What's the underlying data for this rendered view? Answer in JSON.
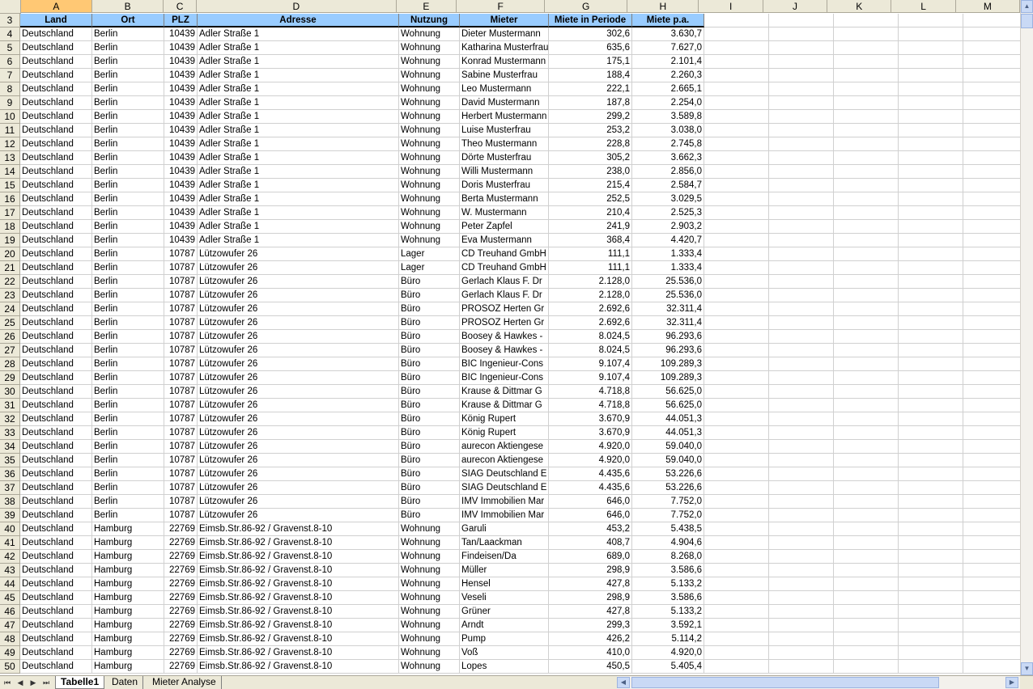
{
  "columns": [
    "A",
    "B",
    "C",
    "D",
    "E",
    "F",
    "G",
    "H",
    "I",
    "J",
    "K",
    "L",
    "M"
  ],
  "selected_column": "A",
  "header_row_number": "3",
  "headers": [
    "Land",
    "Ort",
    "PLZ",
    "Adresse",
    "Nutzung",
    "Mieter",
    "Miete in Periode",
    "Miete p.a."
  ],
  "rows": [
    [
      "4",
      "Deutschland",
      "Berlin",
      "10439",
      "Adler Straße 1",
      "Wohnung",
      "Dieter Mustermann",
      "302,6",
      "3.630,7"
    ],
    [
      "5",
      "Deutschland",
      "Berlin",
      "10439",
      "Adler Straße 1",
      "Wohnung",
      "Katharina Musterfrau",
      "635,6",
      "7.627,0"
    ],
    [
      "6",
      "Deutschland",
      "Berlin",
      "10439",
      "Adler Straße 1",
      "Wohnung",
      "Konrad Mustermann",
      "175,1",
      "2.101,4"
    ],
    [
      "7",
      "Deutschland",
      "Berlin",
      "10439",
      "Adler Straße 1",
      "Wohnung",
      "Sabine Musterfrau",
      "188,4",
      "2.260,3"
    ],
    [
      "8",
      "Deutschland",
      "Berlin",
      "10439",
      "Adler Straße 1",
      "Wohnung",
      "Leo Mustermann",
      "222,1",
      "2.665,1"
    ],
    [
      "9",
      "Deutschland",
      "Berlin",
      "10439",
      "Adler Straße 1",
      "Wohnung",
      "David Mustermann",
      "187,8",
      "2.254,0"
    ],
    [
      "10",
      "Deutschland",
      "Berlin",
      "10439",
      "Adler Straße 1",
      "Wohnung",
      "Herbert Mustermann",
      "299,2",
      "3.589,8"
    ],
    [
      "11",
      "Deutschland",
      "Berlin",
      "10439",
      "Adler Straße 1",
      "Wohnung",
      "Luise Musterfrau",
      "253,2",
      "3.038,0"
    ],
    [
      "12",
      "Deutschland",
      "Berlin",
      "10439",
      "Adler Straße 1",
      "Wohnung",
      "Theo Mustermann",
      "228,8",
      "2.745,8"
    ],
    [
      "13",
      "Deutschland",
      "Berlin",
      "10439",
      "Adler Straße 1",
      "Wohnung",
      "Dörte Musterfrau",
      "305,2",
      "3.662,3"
    ],
    [
      "14",
      "Deutschland",
      "Berlin",
      "10439",
      "Adler Straße 1",
      "Wohnung",
      "Willi Mustermann",
      "238,0",
      "2.856,0"
    ],
    [
      "15",
      "Deutschland",
      "Berlin",
      "10439",
      "Adler Straße 1",
      "Wohnung",
      "Doris Musterfrau",
      "215,4",
      "2.584,7"
    ],
    [
      "16",
      "Deutschland",
      "Berlin",
      "10439",
      "Adler Straße 1",
      "Wohnung",
      "Berta Mustermann",
      "252,5",
      "3.029,5"
    ],
    [
      "17",
      "Deutschland",
      "Berlin",
      "10439",
      "Adler Straße 1",
      "Wohnung",
      "W. Mustermann",
      "210,4",
      "2.525,3"
    ],
    [
      "18",
      "Deutschland",
      "Berlin",
      "10439",
      "Adler Straße 1",
      "Wohnung",
      "Peter Zapfel",
      "241,9",
      "2.903,2"
    ],
    [
      "19",
      "Deutschland",
      "Berlin",
      "10439",
      "Adler Straße 1",
      "Wohnung",
      "Eva Mustermann",
      "368,4",
      "4.420,7"
    ],
    [
      "20",
      "Deutschland",
      "Berlin",
      "10787",
      "Lützowufer 26",
      "Lager",
      "CD Treuhand GmbH",
      "111,1",
      "1.333,4"
    ],
    [
      "21",
      "Deutschland",
      "Berlin",
      "10787",
      "Lützowufer 26",
      "Lager",
      "CD Treuhand GmbH",
      "111,1",
      "1.333,4"
    ],
    [
      "22",
      "Deutschland",
      "Berlin",
      "10787",
      "Lützowufer 26",
      "Büro",
      "Gerlach Klaus F. Dr",
      "2.128,0",
      "25.536,0"
    ],
    [
      "23",
      "Deutschland",
      "Berlin",
      "10787",
      "Lützowufer 26",
      "Büro",
      "Gerlach Klaus F. Dr",
      "2.128,0",
      "25.536,0"
    ],
    [
      "24",
      "Deutschland",
      "Berlin",
      "10787",
      "Lützowufer 26",
      "Büro",
      "PROSOZ Herten Gr",
      "2.692,6",
      "32.311,4"
    ],
    [
      "25",
      "Deutschland",
      "Berlin",
      "10787",
      "Lützowufer 26",
      "Büro",
      "PROSOZ Herten Gr",
      "2.692,6",
      "32.311,4"
    ],
    [
      "26",
      "Deutschland",
      "Berlin",
      "10787",
      "Lützowufer 26",
      "Büro",
      "Boosey & Hawkes -",
      "8.024,5",
      "96.293,6"
    ],
    [
      "27",
      "Deutschland",
      "Berlin",
      "10787",
      "Lützowufer 26",
      "Büro",
      "Boosey & Hawkes -",
      "8.024,5",
      "96.293,6"
    ],
    [
      "28",
      "Deutschland",
      "Berlin",
      "10787",
      "Lützowufer 26",
      "Büro",
      "BIC Ingenieur-Cons",
      "9.107,4",
      "109.289,3"
    ],
    [
      "29",
      "Deutschland",
      "Berlin",
      "10787",
      "Lützowufer 26",
      "Büro",
      "BIC Ingenieur-Cons",
      "9.107,4",
      "109.289,3"
    ],
    [
      "30",
      "Deutschland",
      "Berlin",
      "10787",
      "Lützowufer 26",
      "Büro",
      "Krause & Dittmar G",
      "4.718,8",
      "56.625,0"
    ],
    [
      "31",
      "Deutschland",
      "Berlin",
      "10787",
      "Lützowufer 26",
      "Büro",
      "Krause & Dittmar G",
      "4.718,8",
      "56.625,0"
    ],
    [
      "32",
      "Deutschland",
      "Berlin",
      "10787",
      "Lützowufer 26",
      "Büro",
      "König Rupert",
      "3.670,9",
      "44.051,3"
    ],
    [
      "33",
      "Deutschland",
      "Berlin",
      "10787",
      "Lützowufer 26",
      "Büro",
      "König Rupert",
      "3.670,9",
      "44.051,3"
    ],
    [
      "34",
      "Deutschland",
      "Berlin",
      "10787",
      "Lützowufer 26",
      "Büro",
      "aurecon Aktiengese",
      "4.920,0",
      "59.040,0"
    ],
    [
      "35",
      "Deutschland",
      "Berlin",
      "10787",
      "Lützowufer 26",
      "Büro",
      "aurecon Aktiengese",
      "4.920,0",
      "59.040,0"
    ],
    [
      "36",
      "Deutschland",
      "Berlin",
      "10787",
      "Lützowufer 26",
      "Büro",
      "SIAG Deutschland E",
      "4.435,6",
      "53.226,6"
    ],
    [
      "37",
      "Deutschland",
      "Berlin",
      "10787",
      "Lützowufer 26",
      "Büro",
      "SIAG Deutschland E",
      "4.435,6",
      "53.226,6"
    ],
    [
      "38",
      "Deutschland",
      "Berlin",
      "10787",
      "Lützowufer 26",
      "Büro",
      "IMV Immobilien Mar",
      "646,0",
      "7.752,0"
    ],
    [
      "39",
      "Deutschland",
      "Berlin",
      "10787",
      "Lützowufer 26",
      "Büro",
      "IMV Immobilien Mar",
      "646,0",
      "7.752,0"
    ],
    [
      "40",
      "Deutschland",
      "Hamburg",
      "22769",
      "Eimsb.Str.86-92 / Gravenst.8-10",
      "Wohnung",
      "Garuli",
      "453,2",
      "5.438,5"
    ],
    [
      "41",
      "Deutschland",
      "Hamburg",
      "22769",
      "Eimsb.Str.86-92 / Gravenst.8-10",
      "Wohnung",
      "Tan/Laackman",
      "408,7",
      "4.904,6"
    ],
    [
      "42",
      "Deutschland",
      "Hamburg",
      "22769",
      "Eimsb.Str.86-92 / Gravenst.8-10",
      "Wohnung",
      "Findeisen/Da",
      "689,0",
      "8.268,0"
    ],
    [
      "43",
      "Deutschland",
      "Hamburg",
      "22769",
      "Eimsb.Str.86-92 / Gravenst.8-10",
      "Wohnung",
      "Müller",
      "298,9",
      "3.586,6"
    ],
    [
      "44",
      "Deutschland",
      "Hamburg",
      "22769",
      "Eimsb.Str.86-92 / Gravenst.8-10",
      "Wohnung",
      "Hensel",
      "427,8",
      "5.133,2"
    ],
    [
      "45",
      "Deutschland",
      "Hamburg",
      "22769",
      "Eimsb.Str.86-92 / Gravenst.8-10",
      "Wohnung",
      "Veseli",
      "298,9",
      "3.586,6"
    ],
    [
      "46",
      "Deutschland",
      "Hamburg",
      "22769",
      "Eimsb.Str.86-92 / Gravenst.8-10",
      "Wohnung",
      "Grüner",
      "427,8",
      "5.133,2"
    ],
    [
      "47",
      "Deutschland",
      "Hamburg",
      "22769",
      "Eimsb.Str.86-92 / Gravenst.8-10",
      "Wohnung",
      "Arndt",
      "299,3",
      "3.592,1"
    ],
    [
      "48",
      "Deutschland",
      "Hamburg",
      "22769",
      "Eimsb.Str.86-92 / Gravenst.8-10",
      "Wohnung",
      "Pump",
      "426,2",
      "5.114,2"
    ],
    [
      "49",
      "Deutschland",
      "Hamburg",
      "22769",
      "Eimsb.Str.86-92 / Gravenst.8-10",
      "Wohnung",
      "Voß",
      "410,0",
      "4.920,0"
    ],
    [
      "50",
      "Deutschland",
      "Hamburg",
      "22769",
      "Eimsb.Str.86-92 / Gravenst.8-10",
      "Wohnung",
      "Lopes",
      "450,5",
      "5.405,4"
    ]
  ],
  "sheet_tabs": [
    {
      "label": "Tabelle1",
      "active": true
    },
    {
      "label": "Daten",
      "active": false
    },
    {
      "label": "Mieter Analyse",
      "active": false
    }
  ],
  "nav_buttons": [
    "⏮",
    "◀",
    "▶",
    "⏭"
  ],
  "colors": {
    "header_fill": "#99ccff",
    "selected_column": "#ffc874",
    "chrome": "#ece9d8"
  }
}
